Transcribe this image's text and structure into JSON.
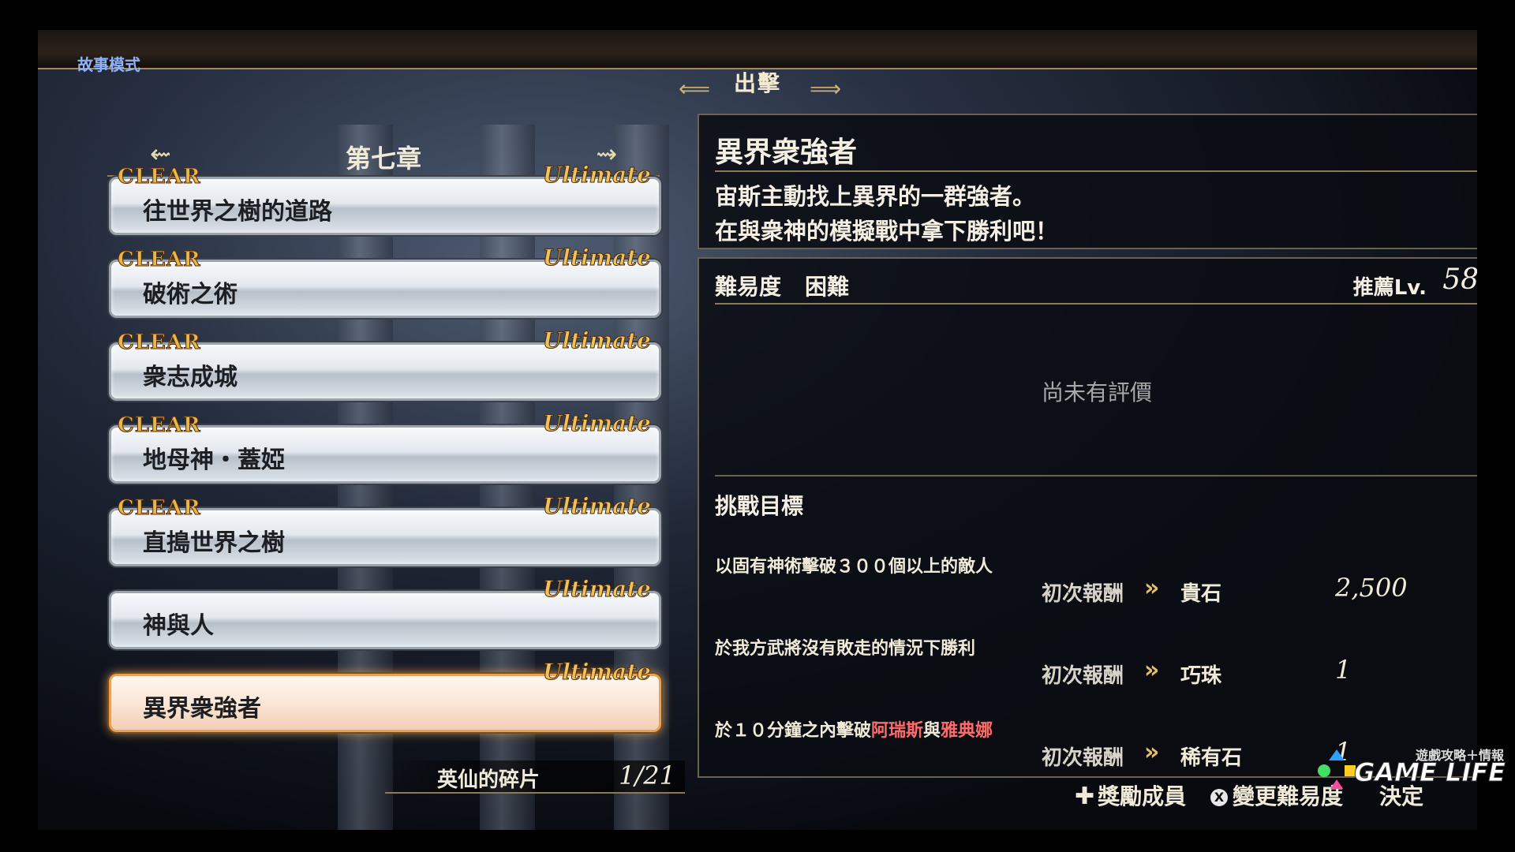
{
  "top": {
    "mode": "故事模式",
    "title": "出擊"
  },
  "chapter": {
    "title": "第七章"
  },
  "stages": [
    {
      "name": "往世界之樹的道路",
      "clear": "CLEAR",
      "ultimate": "Ultimate"
    },
    {
      "name": "破術之術",
      "clear": "CLEAR",
      "ultimate": "Ultimate"
    },
    {
      "name": "衆志成城",
      "clear": "CLEAR",
      "ultimate": "Ultimate"
    },
    {
      "name": "地母神・蓋婭",
      "clear": "CLEAR",
      "ultimate": "Ultimate"
    },
    {
      "name": "直搗世界之樹",
      "clear": "CLEAR",
      "ultimate": "Ultimate"
    },
    {
      "name": "神與人",
      "ultimate": "Ultimate"
    },
    {
      "name": "異界衆強者",
      "ultimate": "Ultimate"
    }
  ],
  "fragments": {
    "label": "英仙的碎片",
    "value": "1/21"
  },
  "info": {
    "title": "異界衆強者",
    "line1": "宙斯主動找上異界的一群強者。",
    "line2": "在與衆神的模擬戰中拿下勝利吧！"
  },
  "detail": {
    "difficulty_label": "難易度",
    "difficulty_value": "困難",
    "recommend_label": "推薦Lv.",
    "recommend_value": "58",
    "no_evaluation": "尚未有評價",
    "goals_title": "挑戰目標"
  },
  "goals": [
    {
      "text": "以固有神術擊破３００個以上的敵人",
      "reward_label": "初次報酬",
      "item": "貴石",
      "value": "2,500"
    },
    {
      "text": "於我方武將沒有敗走的情況下勝利",
      "reward_label": "初次報酬",
      "item": "巧珠",
      "value": "1"
    },
    {
      "text_prefix": "於１０分鐘之內擊破",
      "target1": "阿瑞斯",
      "joiner": "與",
      "target2": "雅典娜",
      "reward_label": "初次報酬",
      "item": "稀有石",
      "value": "1"
    }
  ],
  "hints": {
    "reward_members": "獎勵成員",
    "change_difficulty": "變更難易度",
    "decide": "決定",
    "x_button": "X"
  },
  "watermark": {
    "brand": "GAME LIFE",
    "sub": "遊戲攻略＋情報"
  },
  "colors": {
    "accent_gold": "#e5c068",
    "highlight_red": "#ff6a6a",
    "mode_blue": "#8fb2ff"
  }
}
